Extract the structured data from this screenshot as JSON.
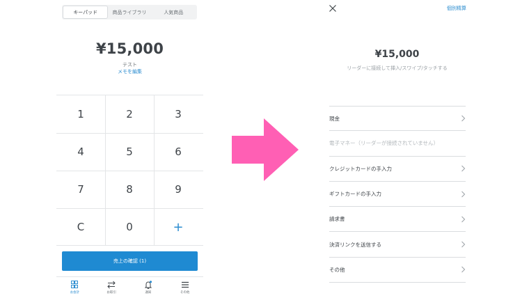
{
  "left": {
    "tabs": [
      {
        "label": "キーパッド",
        "active": true
      },
      {
        "label": "商品ライブラリ",
        "active": false
      },
      {
        "label": "人気商品",
        "active": false
      }
    ],
    "amount": "¥15,000",
    "memo_label": "テスト",
    "memo_edit": "メモを編集",
    "keys": [
      "1",
      "2",
      "3",
      "4",
      "5",
      "6",
      "7",
      "8",
      "9",
      "C",
      "0",
      "+"
    ],
    "confirm_label": "売上の確認 (1)",
    "nav": [
      {
        "label": "お会計",
        "icon": "grid-icon",
        "active": true
      },
      {
        "label": "お取引",
        "icon": "transfer-arrows-icon",
        "active": false
      },
      {
        "label": "通知",
        "icon": "bell-icon",
        "active": false
      },
      {
        "label": "その他",
        "icon": "menu-icon",
        "active": false
      }
    ]
  },
  "right": {
    "close_icon": "close-icon",
    "split_payment": "個別精算",
    "amount": "¥15,000",
    "subtitle": "リーダーに接続して挿入/スワイプ/タッチする",
    "payment_methods": [
      {
        "label": "現金",
        "enabled": true
      },
      {
        "label": "電子マネー（リーダーが接続されていません）",
        "enabled": false
      },
      {
        "label": "クレジットカードの手入力",
        "enabled": true
      },
      {
        "label": "ギフトカードの手入力",
        "enabled": true
      },
      {
        "label": "請求書",
        "enabled": true
      },
      {
        "label": "決済リンクを送信する",
        "enabled": true
      },
      {
        "label": "その他",
        "enabled": true
      }
    ]
  },
  "colors": {
    "accent": "#2c8dd0",
    "confirm_button": "#1f8ad2",
    "arrow": "#ff5fb4",
    "text": "#3e4348",
    "divider": "#d9dcdf"
  }
}
